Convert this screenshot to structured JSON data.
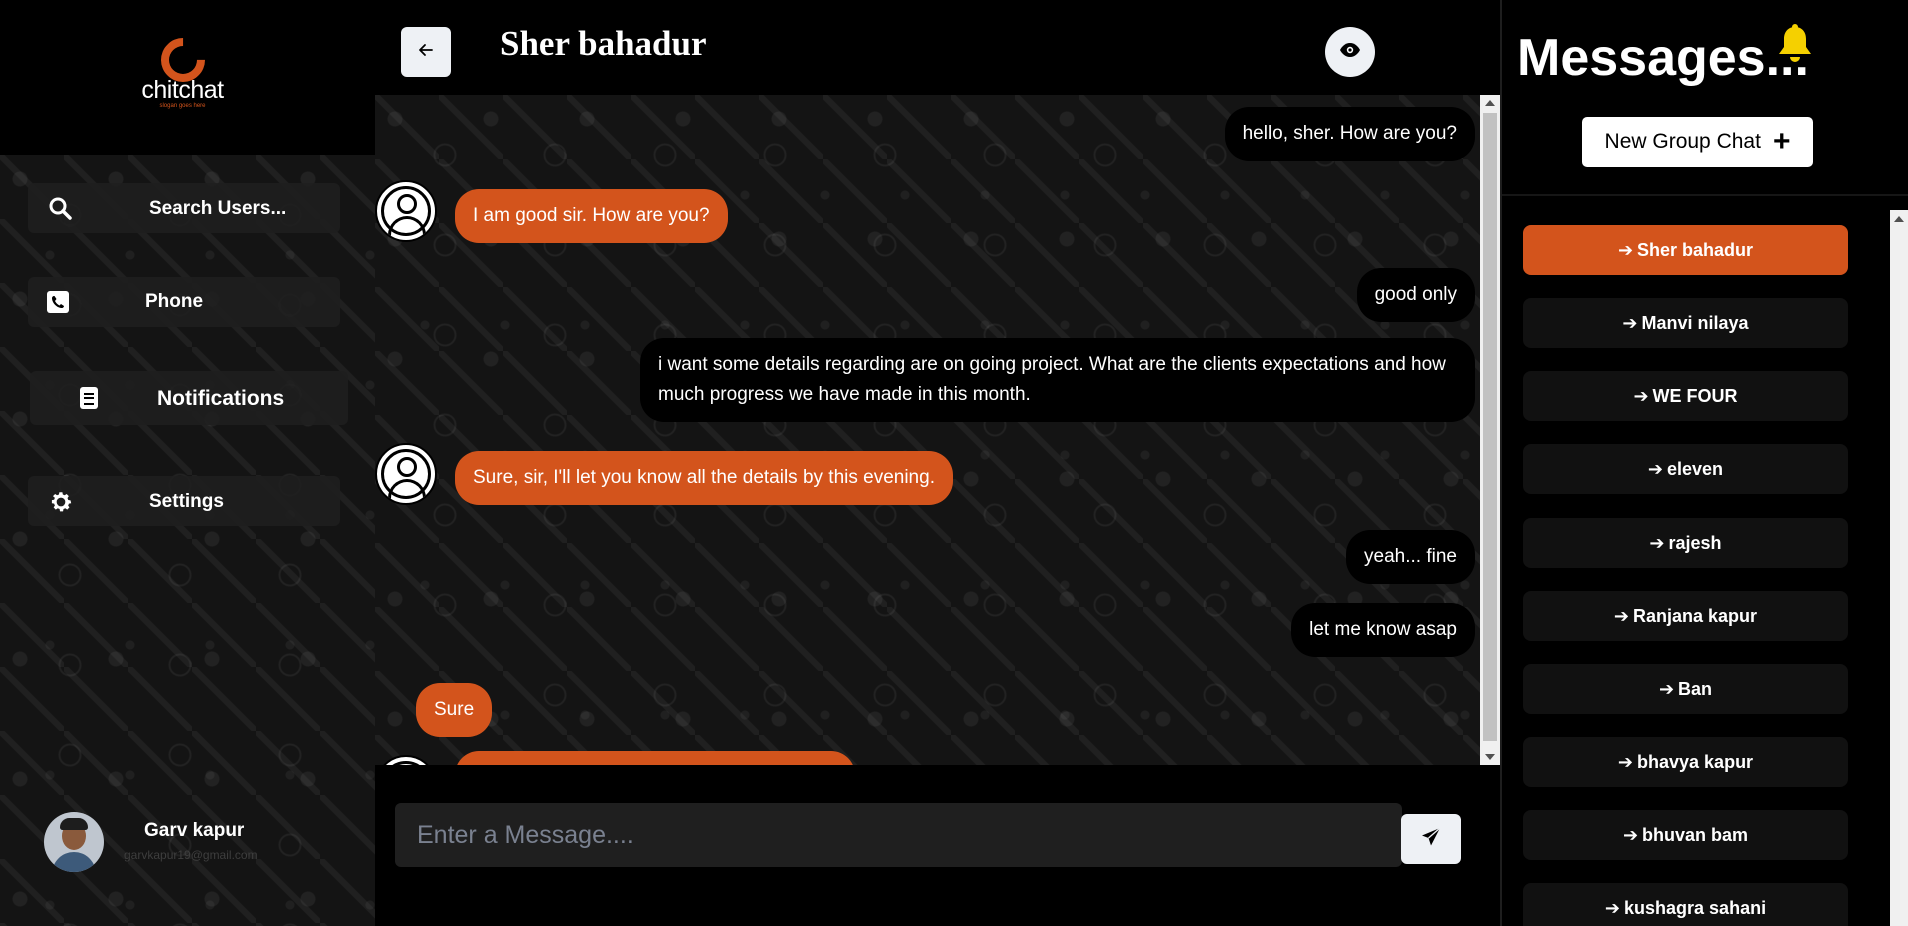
{
  "brand": {
    "name_part1": "chit",
    "name_part2": "chat",
    "slogan": "slogan goes here",
    "accent": "#d3541c"
  },
  "sidebar": {
    "items": [
      {
        "label": "Search Users...",
        "icon": "search-icon"
      },
      {
        "label": "Phone",
        "icon": "phone-icon"
      },
      {
        "label": "Notifications",
        "icon": "notifications-icon"
      },
      {
        "label": "Settings",
        "icon": "gear-icon"
      }
    ],
    "user": {
      "name": "Garv kapur",
      "email": "garvkapur19@gmail.com"
    }
  },
  "chat": {
    "title": "Sher bahadur",
    "messages": [
      {
        "from": "me",
        "text": "hello, sher. How are you?"
      },
      {
        "from": "them",
        "text": "I am good sir. How are you?"
      },
      {
        "from": "me",
        "text": "good only"
      },
      {
        "from": "me",
        "text": "i want some details regarding are on going project. What are the clients expectations and how much progress we have made in this month."
      },
      {
        "from": "them",
        "text": "Sure, sir, I'll let you know all the details by this evening."
      },
      {
        "from": "me",
        "text": "yeah... fine"
      },
      {
        "from": "me",
        "text": "let me know asap"
      },
      {
        "from": "them",
        "text": "Sure"
      }
    ],
    "input_placeholder": "Enter a Message...."
  },
  "messages_panel": {
    "title": "Messages...",
    "new_group_label": "New Group Chat",
    "chats": [
      {
        "name": "Sher bahadur",
        "active": true
      },
      {
        "name": "Manvi nilaya",
        "active": false
      },
      {
        "name": "WE FOUR",
        "active": false
      },
      {
        "name": "eleven",
        "active": false
      },
      {
        "name": "rajesh",
        "active": false
      },
      {
        "name": "Ranjana kapur",
        "active": false
      },
      {
        "name": "Ban",
        "active": false
      },
      {
        "name": "bhavya kapur",
        "active": false
      },
      {
        "name": "bhuvan bam",
        "active": false
      },
      {
        "name": "kushagra sahani",
        "active": false
      }
    ]
  }
}
